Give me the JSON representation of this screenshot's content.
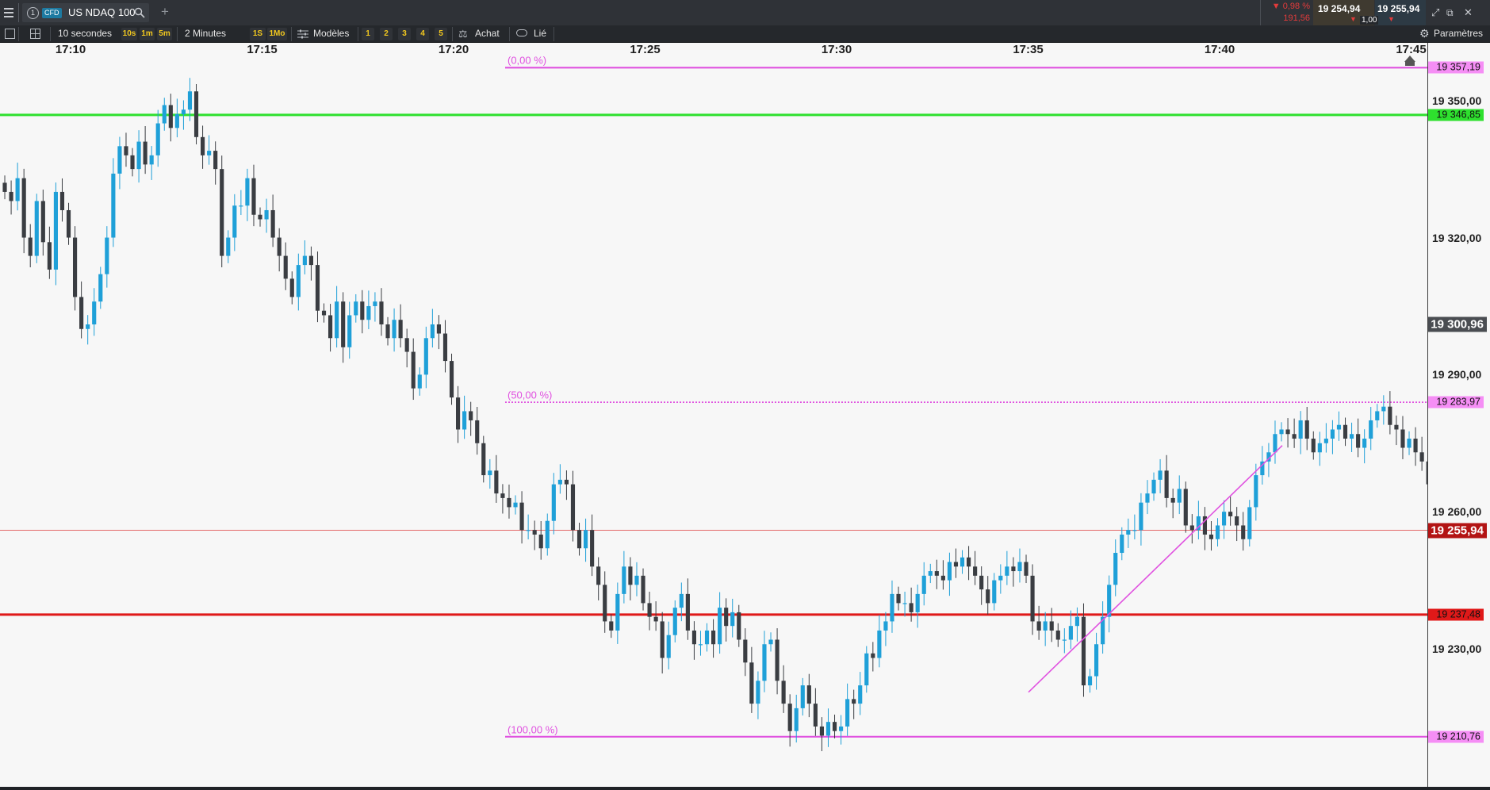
{
  "instrument": {
    "badge": "CFD",
    "index_number": "1",
    "name": "US NDAQ 100"
  },
  "quote": {
    "change_pct": "0,98 %",
    "change_abs": "191,56",
    "bid": "19 254,94",
    "ask": "19 255,94",
    "qty": "1,00",
    "down_color": "#e23b3b"
  },
  "toolbar": {
    "interval": "10 secondes",
    "quick_intervals": [
      "10s",
      "1m",
      "5m"
    ],
    "range": "2 Minutes",
    "range_buttons": [
      "1S",
      "1Mo"
    ],
    "templates_label": "Modèles",
    "template_slots": [
      "1",
      "2",
      "3",
      "4",
      "5"
    ],
    "achat_label": "Achat",
    "lie_label": "Lié",
    "params_label": "Paramètres"
  },
  "icons": {
    "menu": "menu-icon",
    "search": "search-icon",
    "add_tab": "plus-icon",
    "list": "list-icon",
    "layout": "layout-icon",
    "templates": "sliders-icon",
    "achat": "scale-icon",
    "lie": "link-icon",
    "settings": "gear-icon",
    "detach": "detach-icon",
    "restore": "restore-icon",
    "close": "close-icon"
  },
  "chart_data": {
    "type": "candlestick",
    "x_ticks": [
      "17:10",
      "17:15",
      "17:20",
      "17:25",
      "17:30",
      "17:35",
      "17:40",
      "17:45"
    ],
    "y_ticks": [
      "19 350,00",
      "19 320,00",
      "19 290,00",
      "19 260,00",
      "19 230,00"
    ],
    "y_tick_values": [
      19350,
      19320,
      19290,
      19260,
      19230
    ],
    "ylim": [
      19199.1,
      19359.5
    ],
    "candle_interval": "10 s",
    "colors": {
      "up": "#1fa0d8",
      "down": "#3a3d42"
    },
    "candles_close": [
      19330,
      19328,
      19333,
      19320,
      19316,
      19328,
      19319,
      19313,
      19330,
      19326,
      19320,
      19307,
      19300,
      19301,
      19306,
      19312,
      19320,
      19334,
      19340,
      19338,
      19335,
      19341,
      19336,
      19338,
      19345,
      19349,
      19344,
      19347,
      19348,
      19352,
      19342,
      19338,
      19339,
      19335,
      19316,
      19320,
      19327,
      19327,
      19333,
      19325,
      19324,
      19326,
      19320,
      19316,
      19311,
      19307,
      19314,
      19316,
      19314,
      19304,
      19303,
      19298,
      19306,
      19296,
      19303,
      19306,
      19302,
      19305,
      19306,
      19301,
      19298,
      19302,
      19298,
      19295,
      19287,
      19290,
      19298,
      19301,
      19299,
      19293,
      19285,
      19278,
      19282,
      19280,
      19275,
      19268,
      19269,
      19264,
      19263,
      19261,
      19262,
      19256,
      19256,
      19255,
      19252,
      19258,
      19266,
      19267,
      19266,
      19256,
      19252,
      19256,
      19248,
      19244,
      19236,
      19234,
      19242,
      19248,
      19244,
      19246,
      19240,
      19237,
      19236,
      19228,
      19233,
      19239,
      19242,
      19234,
      19231,
      19231,
      19234,
      19231,
      19239,
      19235,
      19238,
      19232,
      19227,
      19218,
      19223,
      19231,
      19232,
      19223,
      19218,
      19212,
      19217,
      19222,
      19218,
      19213,
      19211,
      19214,
      19212,
      19213,
      19219,
      19218,
      19222,
      19229,
      19228,
      19234,
      19236,
      19242,
      19240,
      19240,
      19238,
      19242,
      19246,
      19247,
      19246,
      19245,
      19249,
      19248,
      19250,
      19248,
      19246,
      19243,
      19240,
      19245,
      19246,
      19248,
      19247,
      19249,
      19246,
      19236,
      19234,
      19236,
      19234,
      19232,
      19232,
      19235,
      19237,
      19222,
      19224,
      19231,
      19237,
      19244,
      19251,
      19255,
      19256,
      19256,
      19262,
      19264,
      19267,
      19269,
      19263,
      19262,
      19265,
      19257,
      19256,
      19259,
      19255,
      19254,
      19257,
      19260,
      19259,
      19257,
      19254,
      19261,
      19268,
      19271,
      19273,
      19277,
      19278,
      19277,
      19276,
      19280,
      19276,
      19273,
      19275,
      19276,
      19278,
      19279,
      19276,
      19277,
      19274,
      19276,
      19280,
      19282,
      19283,
      19279,
      19278,
      19274,
      19276,
      19273,
      19271,
      19266,
      19256,
      19248,
      19245,
      19245,
      19254,
      19256,
      19255
    ],
    "fib_levels": [
      {
        "label": "(0,00 %)",
        "value": "19 357,19",
        "price": 19357.19
      },
      {
        "label": "(50,00 %)",
        "value": "19 283,97",
        "price": 19283.97
      },
      {
        "label": "(100,00 %)",
        "value": "19 210,76",
        "price": 19210.76
      }
    ],
    "horizontal_lines": [
      {
        "value": "19 346,85",
        "price": 19346.85,
        "color": "#2ee02e"
      },
      {
        "value": "19 237,48",
        "price": 19237.48,
        "color": "#e01919"
      }
    ],
    "current_price": {
      "value": "19 255,94",
      "price": 19255.94,
      "color": "#b31414"
    },
    "crosshair": {
      "value": "19 300,96",
      "price": 19300.96
    },
    "trendline": {
      "from_price": 19220.5,
      "to_price": 19274.5,
      "color": "#e052e0"
    }
  }
}
